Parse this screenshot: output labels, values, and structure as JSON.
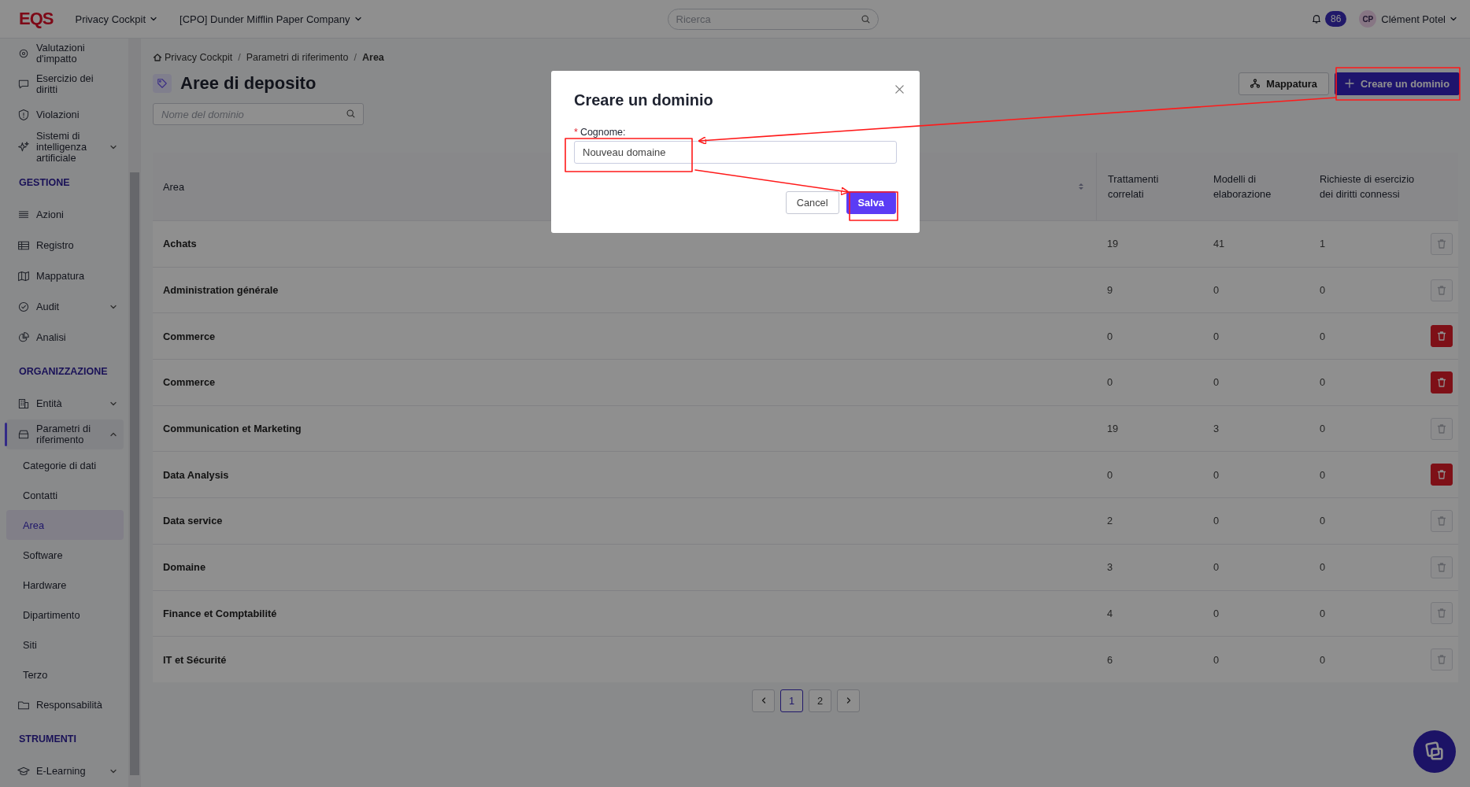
{
  "topbar": {
    "logo": "EQS",
    "product": "Privacy Cockpit",
    "company": "[CPO] Dunder Mifflin Paper Company",
    "search": {
      "placeholder": "Ricerca"
    },
    "notifications": "86",
    "user": {
      "initials": "CP",
      "name": "Clément Potel"
    }
  },
  "sidebar": {
    "sections": [
      {
        "items": [
          {
            "kind": "link",
            "label": "Valutazioni d'impatto",
            "selected": false
          },
          {
            "kind": "link",
            "label": "Esercizio dei diritti",
            "selected": false
          },
          {
            "kind": "link",
            "label": "Violazioni",
            "selected": false
          },
          {
            "kind": "group",
            "label": "Sistemi di intelligenza artificiale",
            "selected": false,
            "expanded": false
          }
        ]
      },
      {
        "heading": "GESTIONE",
        "items": [
          {
            "kind": "link",
            "label": "Azioni",
            "selected": false
          },
          {
            "kind": "link",
            "label": "Registro",
            "selected": false
          },
          {
            "kind": "link",
            "label": "Mappatura",
            "selected": false
          },
          {
            "kind": "group",
            "label": "Audit",
            "selected": false,
            "expanded": false
          },
          {
            "kind": "link",
            "label": "Analisi",
            "selected": false
          }
        ]
      },
      {
        "heading": "ORGANIZZAZIONE",
        "items": [
          {
            "kind": "group",
            "label": "Entità",
            "selected": false,
            "expanded": false
          },
          {
            "kind": "group",
            "label": "Parametri di riferimento",
            "selected": true,
            "expanded": true,
            "children": [
              {
                "label": "Categorie di dati",
                "selected": false
              },
              {
                "label": "Contatti",
                "selected": false
              },
              {
                "label": "Area",
                "selected": true
              },
              {
                "label": "Software",
                "selected": false
              },
              {
                "label": "Hardware",
                "selected": false
              },
              {
                "label": "Dipartimento",
                "selected": false
              },
              {
                "label": "Siti",
                "selected": false
              },
              {
                "label": "Terzo",
                "selected": false
              }
            ]
          },
          {
            "kind": "link",
            "label": "Responsabilità",
            "selected": false
          }
        ]
      },
      {
        "heading": "STRUMENTI",
        "items": [
          {
            "kind": "group",
            "label": "E-Learning",
            "selected": false,
            "expanded": false
          }
        ]
      }
    ]
  },
  "breadcrumb": {
    "separator": "/",
    "items": [
      "Privacy Cockpit",
      "Parametri di riferimento",
      "Area"
    ]
  },
  "page_title": "Aree di deposito",
  "filter": {
    "placeholder": "Nome del dominio"
  },
  "actions": [
    {
      "kind": "secondary",
      "label": "Mappatura"
    },
    {
      "kind": "primary",
      "label": "Creare un dominio"
    }
  ],
  "table": {
    "columns": [
      "Area",
      "Trattamenti correlati",
      "Modelli di elaborazione",
      "Richieste di esercizio dei diritti connessi"
    ],
    "rows": [
      {
        "cells": [
          "Achats",
          "19",
          "41",
          "1"
        ],
        "deletable": false
      },
      {
        "cells": [
          "Administration générale",
          "9",
          "0",
          "0"
        ],
        "deletable": false
      },
      {
        "cells": [
          "Commerce",
          "0",
          "0",
          "0"
        ],
        "deletable": true
      },
      {
        "cells": [
          "Commerce",
          "0",
          "0",
          "0"
        ],
        "deletable": true
      },
      {
        "cells": [
          "Communication et Marketing",
          "19",
          "3",
          "0"
        ],
        "deletable": false
      },
      {
        "cells": [
          "Data Analysis",
          "0",
          "0",
          "0"
        ],
        "deletable": true
      },
      {
        "cells": [
          "Data service",
          "2",
          "0",
          "0"
        ],
        "deletable": false
      },
      {
        "cells": [
          "Domaine",
          "3",
          "0",
          "0"
        ],
        "deletable": false
      },
      {
        "cells": [
          "Finance et Comptabilité",
          "4",
          "0",
          "0"
        ],
        "deletable": false
      },
      {
        "cells": [
          "IT et Sécurité",
          "6",
          "0",
          "0"
        ],
        "deletable": false
      }
    ]
  },
  "pagination": {
    "pages": [
      {
        "label": "1",
        "selected": true
      },
      {
        "label": "2",
        "selected": false
      }
    ]
  },
  "modal": {
    "title": "Creare un dominio",
    "field": {
      "label": "Cognome:",
      "required_mark": "*",
      "value": "Nouveau domaine"
    },
    "buttons": [
      {
        "kind": "secondary",
        "label": "Cancel"
      },
      {
        "kind": "primary",
        "label": "Salva"
      }
    ]
  }
}
